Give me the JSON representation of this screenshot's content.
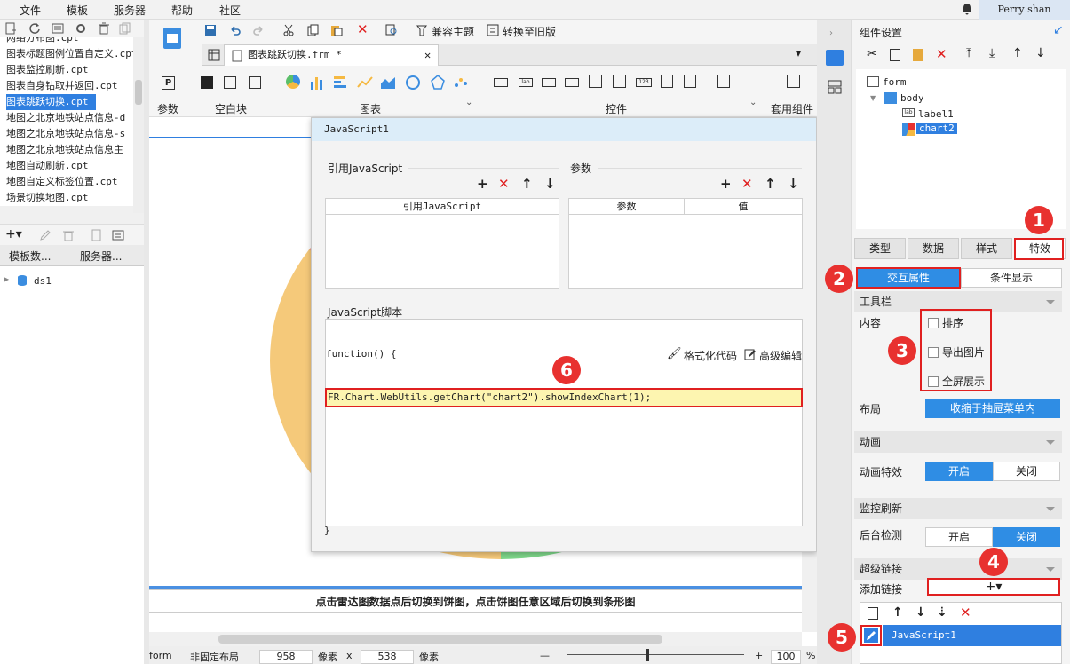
{
  "menu": [
    "文件",
    "模板",
    "服务器",
    "帮助",
    "社区"
  ],
  "user": "Perry shan",
  "left": {
    "files": [
      "网络分布图.cpt",
      "图表标题图例位置自定义.cpt",
      "图表监控刷新.cpt",
      "图表自身钻取并返回.cpt",
      "图表跳跃切换.cpt",
      "地图之北京地铁站点信息-d",
      "地图之北京地铁站点信息-s",
      "地图之北京地铁站点信息主",
      "地图自动刷新.cpt",
      "地图自定义标签位置.cpt",
      "场景切换地图.cpt"
    ],
    "selected_index": 4,
    "tabs": [
      "模板数...",
      "服务器..."
    ],
    "datasource": "ds1"
  },
  "toolbar": {
    "compat_theme": "兼容主题",
    "convert_old": "转换至旧版",
    "groups": [
      "参数",
      "空白块",
      "图表",
      "控件",
      "套用组件"
    ]
  },
  "tab_title": "图表跳跃切换.frm *",
  "canvas": {
    "caption": "点击雷达图数据点后切换到饼图，点击饼图任意区域后切换到条形图"
  },
  "status": {
    "form": "form",
    "layout": "非固定布局",
    "width": "958",
    "px1": "像素",
    "x": "x",
    "height": "538",
    "px2": "像素",
    "zoom": "100",
    "pct": "%"
  },
  "dialog": {
    "title": "JavaScript1",
    "ref_label": "引用JavaScript",
    "param_label": "参数",
    "ref_col": "引用JavaScript",
    "param_col": "参数",
    "value_col": "值",
    "script_label": "JavaScript脚本",
    "func_open": "function() {",
    "format_code": "格式化代码",
    "advanced_edit": "高级编辑",
    "code": "FR.Chart.WebUtils.getChart(\"chart2\").showIndexChart(1);",
    "func_close": "}"
  },
  "right": {
    "title": "组件设置",
    "tree": [
      "form",
      "body",
      "label1",
      "chart2"
    ],
    "tabs": [
      "类型",
      "数据",
      "样式",
      "特效"
    ],
    "sub_tabs": [
      "交互属性",
      "条件显示"
    ],
    "toolbar_section": "工具栏",
    "content_label": "内容",
    "checkboxes": [
      "排序",
      "导出图片",
      "全屏展示"
    ],
    "layout_label": "布局",
    "layout_value": "收缩于抽屉菜单内",
    "anim_section": "动画",
    "anim_label": "动画特效",
    "anim_on": "开启",
    "anim_off": "关闭",
    "monitor_section": "监控刷新",
    "monitor_label": "后台检测",
    "monitor_on": "开启",
    "monitor_off": "关闭",
    "link_section": "超级链接",
    "add_link": "添加链接",
    "add_symbol": "+▾",
    "link_item": "JavaScript1"
  },
  "badges": [
    "1",
    "2",
    "3",
    "4",
    "5",
    "6"
  ],
  "colors": {
    "accent": "#2f8de4",
    "badge": "#e8312f",
    "highlight": "#fdf5b0"
  }
}
